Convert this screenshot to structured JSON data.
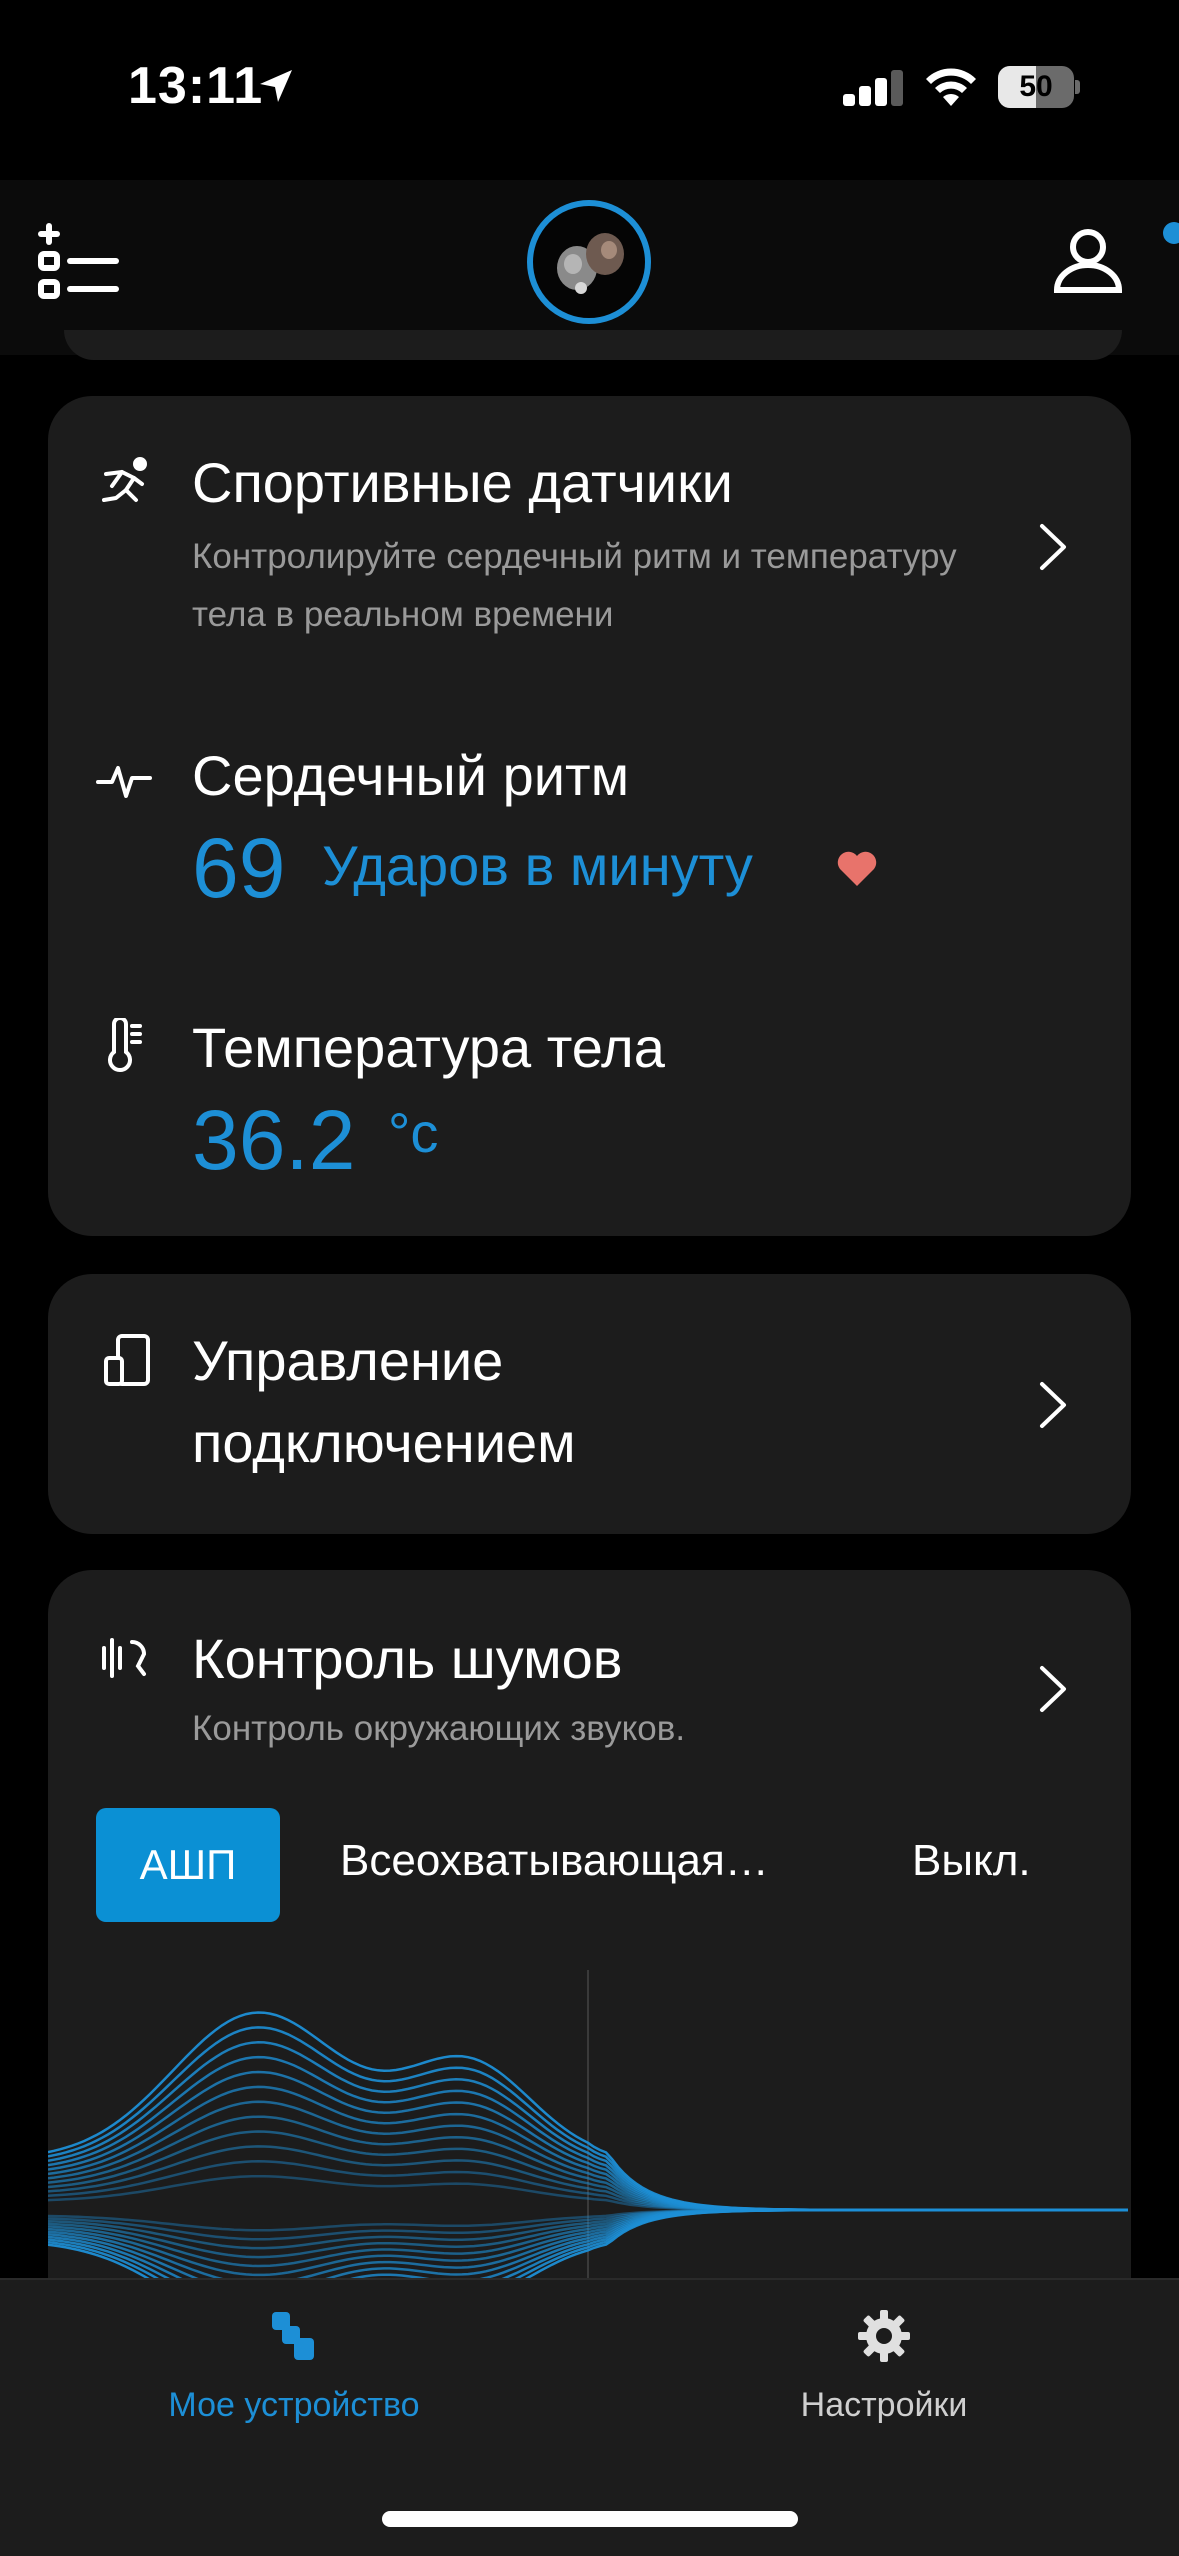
{
  "status_bar": {
    "time": "13:11",
    "battery": "50",
    "battery_level": 0.5
  },
  "header": {
    "avatar_icon": "earbuds-icon",
    "left_icon": "add-list-icon",
    "right_icon": "profile-icon",
    "notification": true
  },
  "sports_sensors": {
    "title": "Спортивные датчики",
    "subtitle": "Контролируйте сердечный ритм и температуру тела в реальном времени",
    "heart_rate": {
      "title": "Сердечный ритм",
      "value": "69",
      "unit": "Ударов в минуту"
    },
    "body_temp": {
      "title": "Температура тела",
      "value": "36.2",
      "unit": "°c"
    }
  },
  "connection": {
    "title_line1": "Управление",
    "title_line2": "подключением"
  },
  "noise_control": {
    "title": "Контроль шумов",
    "subtitle": "Контроль окружающих звуков.",
    "modes": [
      "АШП",
      "Всеохватывающая…",
      "Выкл."
    ],
    "selected": "АШП"
  },
  "tabs": [
    {
      "label": "Мое устройство",
      "active": true
    },
    {
      "label": "Настройки",
      "active": false
    }
  ],
  "colors": {
    "accent": "#1d8fd6",
    "card": "#1c1c1c",
    "heart": "#e8736b",
    "subtitle": "#9a9a9a"
  }
}
